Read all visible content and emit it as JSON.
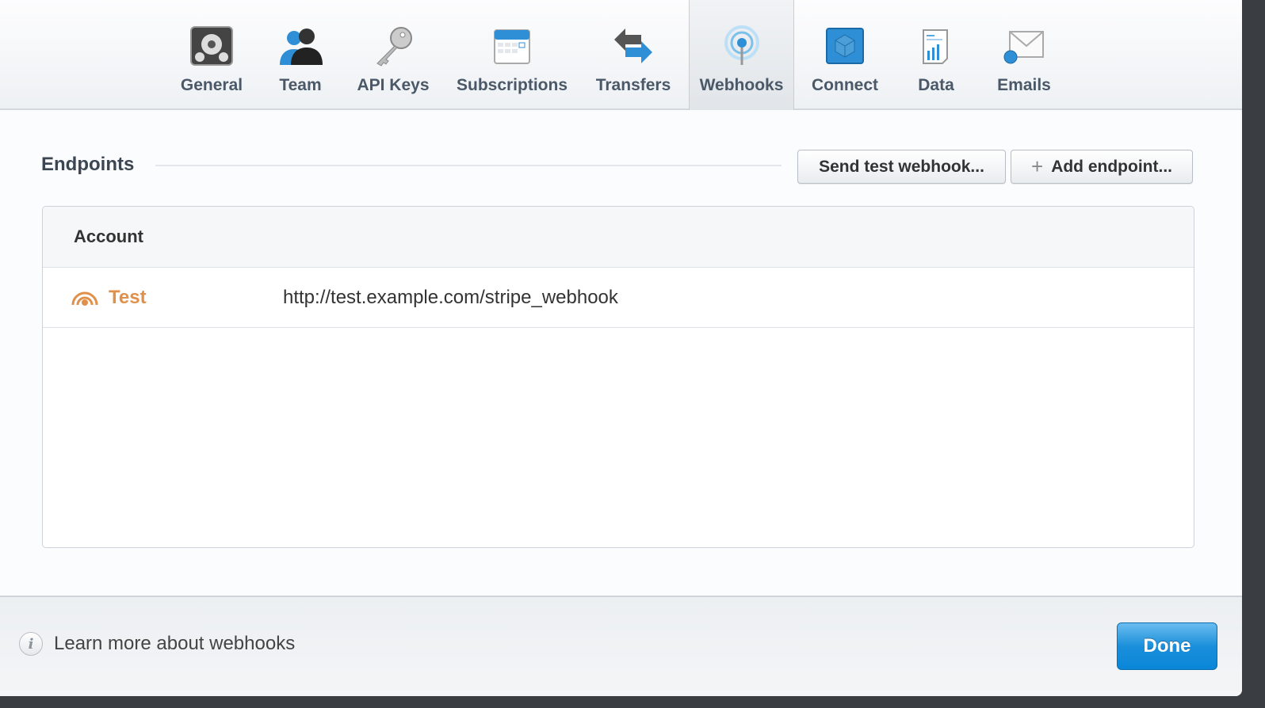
{
  "tabs": [
    {
      "label": "General",
      "icon": "gear-icon"
    },
    {
      "label": "Team",
      "icon": "team-icon"
    },
    {
      "label": "API Keys",
      "icon": "key-icon"
    },
    {
      "label": "Subscriptions",
      "icon": "calendar-icon"
    },
    {
      "label": "Transfers",
      "icon": "transfer-arrows-icon"
    },
    {
      "label": "Webhooks",
      "icon": "broadcast-icon",
      "active": true
    },
    {
      "label": "Connect",
      "icon": "cube-icon"
    },
    {
      "label": "Data",
      "icon": "report-chart-icon"
    },
    {
      "label": "Emails",
      "icon": "envelope-icon"
    }
  ],
  "endpoints": {
    "title": "Endpoints",
    "send_test_label": "Send test webhook...",
    "add_endpoint_label": "Add endpoint...",
    "table_header": "Account",
    "rows": [
      {
        "mode": "Test",
        "url": "http://test.example.com/stripe_webhook"
      }
    ]
  },
  "footer": {
    "learn_more": "Learn more about webhooks",
    "done_label": "Done",
    "info_glyph": "i"
  },
  "colors": {
    "accent": "#1a8fda",
    "test_mode": "#e0904a"
  }
}
